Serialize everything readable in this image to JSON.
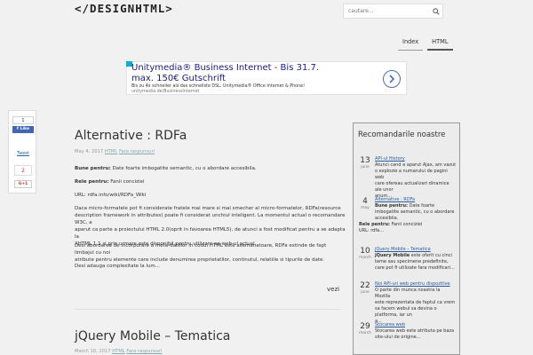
{
  "header": {
    "logo": "</DESIGNHTML>",
    "search_placeholder": "cautare...",
    "nav": [
      "Index",
      "HTML"
    ]
  },
  "ad": {
    "title_line1": "Unitymedia® Business Internet - Bis 31.7.",
    "title_line2": "max. 150€ Gutschrift",
    "desc": "Bis zu 4x schneller als das schnellste DSL: Unitymedia® Office Internet & Phone!",
    "url": "unitymedia.de/BusinessInternet"
  },
  "share": {
    "fb_count": "1",
    "fb_like": "Like",
    "tweet": "Tweet",
    "gp_count": "2",
    "gp_label": "G+1"
  },
  "article1": {
    "title": "Alternative : RDFa",
    "date": "May 4, 2017",
    "category": "HTML",
    "comments": "Fara raspunsuri",
    "p1_label": "Bune pentru:",
    "p1_text": " Date foarte imbogatite semantic, cu o abordare accesibila.",
    "p2_label": "Rele pentru:",
    "p2_text": " Fanii conciziei",
    "p3": "URL: rdfa.info/wiki/RDFa_Wiki",
    "p4_lines": [
      "Daca micro-formatele pot fi considerate fratele mai mare si mai smecher al micro-formatelor, RDFa(resource",
      "description framework in attributes) poate fi considerat unchiul inteligent. La momentul actual o recomandare W3C, a",
      "aparut ca parte a proiectului HTML 2.0(oprit in favoarea HTML5), de atunci a fost modificat pentru a se adapta la",
      "XHTML 1.1 si prin urmare este disponibil pentru utilizare pe web-ul actual."
    ],
    "p5_lines": [
      "Desi abordarea de incorporare a meta-datelor in codul HTML este asemanatoare, RDFa extinde de fapt limbajul cu noi",
      "atribute pentru elemente care include denumirea proprietatilor, continutul, relatiile si tipurile de date."
    ],
    "p6": "Desi adauga complexitate la lum...",
    "more": "vezi"
  },
  "article2": {
    "title": "jQuery Mobile – Tematica",
    "date": "March 10, 2017",
    "category": "HTML",
    "comments": "Fara raspunsuri"
  },
  "sidebar": {
    "title": "Recomandarile noastre",
    "items": [
      {
        "day": "13",
        "month": "june",
        "head": "API-ul History",
        "lines": [
          "Atunci cand a aparut Ajax, am vazut",
          "o explozie a numarului de pagini web",
          "care ofereau actualizari dinamice ale unor",
          "anum..."
        ]
      },
      {
        "day": "4",
        "month": "may",
        "head": "Alternative : RDFa",
        "lines": [
          "Bune pentru: Date foarte",
          "imbogatite semantic, cu o abordare",
          "accesibila."
        ],
        "bold1": "Bune pentru:",
        "extra_label": "Rele pentru:",
        "extra_text": " Fanii conciziei",
        "extra2": "URL: rdfa..."
      },
      {
        "day": "10",
        "month": "march",
        "head": "jQuery Mobile – Tematica",
        "lines": [
          "jQuery Mobile este oferit cu cinci",
          "teme sau specimene predefinite,",
          "care pot fi utilizate fara modificari..."
        ],
        "bold1": "jQuery Mobile"
      },
      {
        "day": "22",
        "month": "june",
        "head": "Noi API-uri web pentru dispozitive",
        "lines": [
          "O parte din munca noastra la Mozilla",
          "este reprezentata de faptul ca vrem",
          "sa facem webul sa devina o platforma, iar un",
          "a..."
        ]
      },
      {
        "day": "29",
        "month": "march",
        "head": "Stocarea web",
        "lines": [
          "Stocarea web este atributa pe baza",
          "site-ului de origine..."
        ]
      }
    ]
  }
}
